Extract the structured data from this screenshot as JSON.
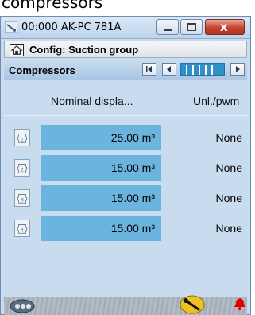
{
  "caption": {
    "text": "compressors"
  },
  "window": {
    "title": "00:000 AK-PC 781A",
    "buttons": {
      "close_glyph": "x"
    }
  },
  "config": {
    "title": "Config: Suction group"
  },
  "section": {
    "title": "Compressors"
  },
  "table": {
    "columns": {
      "displacement": "Nominal displa...",
      "unloader": "Unl./pwm"
    },
    "rows": [
      {
        "index": "1",
        "displacement": "25.00 m³",
        "unloader": "None"
      },
      {
        "index": "2",
        "displacement": "15.00 m³",
        "unloader": "None"
      },
      {
        "index": "3",
        "displacement": "15.00 m³",
        "unloader": "None"
      },
      {
        "index": "4",
        "displacement": "15.00 m³",
        "unloader": "None"
      }
    ]
  },
  "icons": {
    "app": "thermometer-icon",
    "home": "home-icon",
    "nav_first": "skip-first-icon",
    "nav_prev": "previous-icon",
    "nav_next": "next-icon",
    "compressor": "compressor-icon",
    "bottom_left": "compressor-group-icon",
    "wrench": "wrench-icon",
    "alarm": "alarm-bell-icon"
  },
  "colors": {
    "selected_cell": "#6ab4dd",
    "pager": "#2f8fc8",
    "alarm": "#e00000",
    "wrench_bg": "#f0c020",
    "close_button": "#c6422e"
  }
}
